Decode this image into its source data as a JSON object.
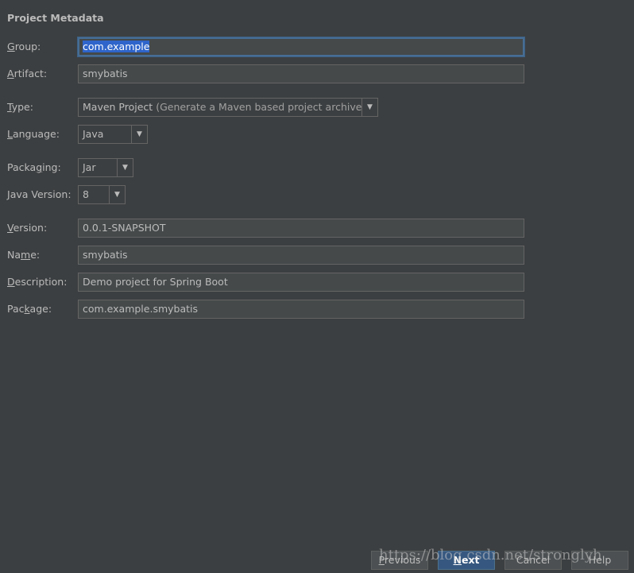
{
  "section_title": "Project Metadata",
  "fields": {
    "group": {
      "label_m": "G",
      "label_rest": "roup:",
      "value": "com.example"
    },
    "artifact": {
      "label_m": "A",
      "label_rest": "rtifact:",
      "value": "smybatis"
    },
    "version": {
      "label_m": "V",
      "label_rest": "ersion:",
      "value": "0.0.1-SNAPSHOT"
    },
    "name": {
      "label_pre": "Na",
      "label_m": "m",
      "label_rest": "e:",
      "value": "smybatis"
    },
    "description": {
      "label_m": "D",
      "label_rest": "escription:",
      "value": "Demo project for Spring Boot"
    },
    "package": {
      "label_pre": "Pac",
      "label_m": "k",
      "label_rest": "age:",
      "value": "com.example.smybatis"
    }
  },
  "combos": {
    "type": {
      "label_m": "T",
      "label_rest": "ype:",
      "value": "Maven Project",
      "hint": "(Generate a Maven based project archive)"
    },
    "language": {
      "label_m": "L",
      "label_rest": "anguage:",
      "value": "Java"
    },
    "packaging": {
      "label_pre": "Packa",
      "label_m": "g",
      "label_rest": "ing:",
      "value": "Jar"
    },
    "java_version": {
      "label_m": "J",
      "label_rest": "ava Version:",
      "value": "8"
    }
  },
  "buttons": {
    "previous": {
      "m": "P",
      "rest": "revious"
    },
    "next": {
      "m": "N",
      "rest": "ext"
    },
    "cancel": {
      "label": "Cancel"
    },
    "help": {
      "label": "Help"
    }
  },
  "icons": {
    "dropdown_arrow": "▼"
  },
  "watermark": "https://blog.csdn.net/stronglyh"
}
